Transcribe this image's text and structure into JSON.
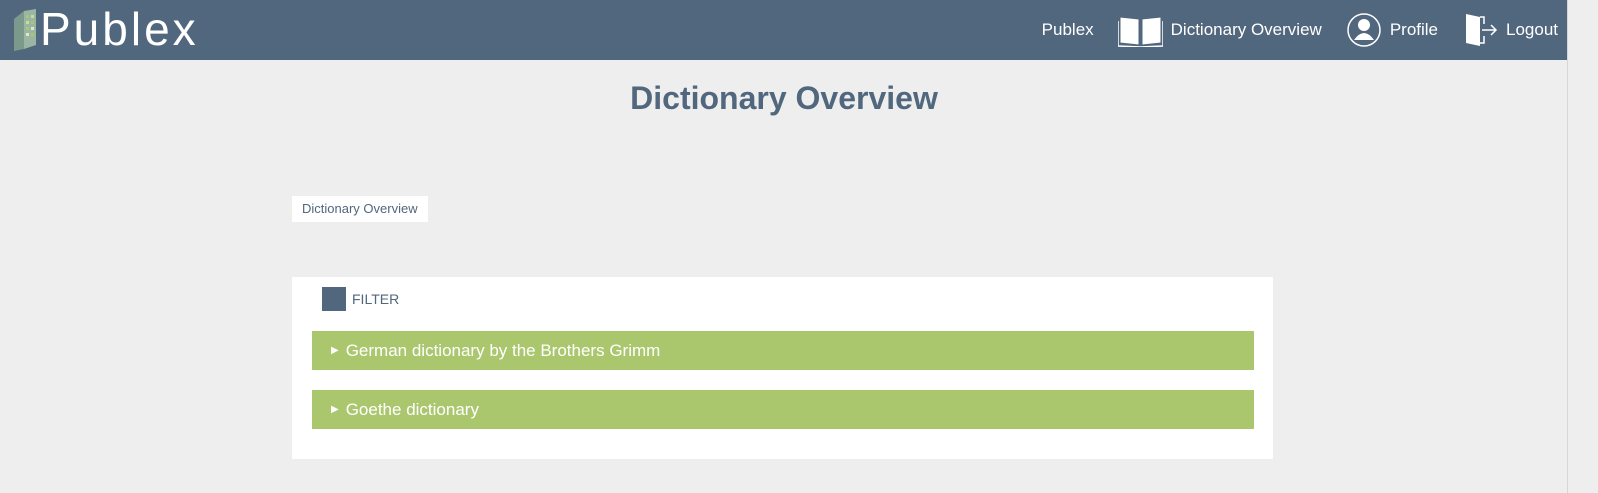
{
  "header": {
    "logo_text": "Publex",
    "nav": {
      "home_label": "Publex",
      "dictionary_label": "Dictionary Overview",
      "profile_label": "Profile",
      "logout_label": "Logout"
    },
    "icons": {
      "dictionary": "open-book-icon",
      "profile": "user-circle-icon",
      "logout": "logout-door-icon"
    },
    "colors": {
      "bar": "#51677d",
      "accent": "#aac76d"
    }
  },
  "main": {
    "title": "Dictionary Overview",
    "breadcrumb": "Dictionary Overview",
    "filter_label": "FILTER",
    "dictionaries": [
      {
        "label": "German dictionary by the Brothers Grimm",
        "arrow": "▶"
      },
      {
        "label": "Goethe dictionary",
        "arrow": "▶"
      }
    ],
    "colors": {
      "row": "#abc76e",
      "title": "#51677d"
    }
  }
}
